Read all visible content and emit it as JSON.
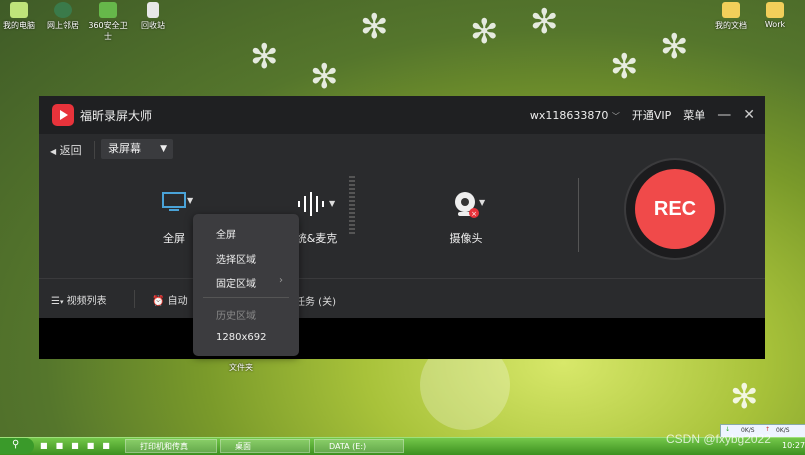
{
  "desktop": {
    "icons": [
      {
        "label": "我的电脑",
        "icon": "computer-icon"
      },
      {
        "label": "网上邻居",
        "icon": "network-icon"
      },
      {
        "label": "360安全卫士",
        "icon": "shield-app-icon"
      },
      {
        "label": "回收站",
        "icon": "recycle-bin-icon"
      },
      {
        "label": "我的文档",
        "icon": "folder-icon"
      },
      {
        "label": "Work",
        "icon": "folder-icon"
      }
    ],
    "below_window_label": "文件夹"
  },
  "app": {
    "name": "福昕录屏大师",
    "account": "wx118633870",
    "vip_label": "开通VIP",
    "menu_label": "菜单",
    "minimize_glyph": "—",
    "close_glyph": "✕",
    "back_label": "返回",
    "mode_label": "录屏幕",
    "sources": {
      "screen_label": "全屏",
      "audio_label": "系统&麦克",
      "camera_label": "摄像头"
    },
    "rec_label": "REC",
    "bottom": {
      "video_list_label": "视频列表",
      "auto_label": "自动",
      "task_label": "计划任务 (关)"
    },
    "dropdown": {
      "items": [
        "全屏",
        "选择区域",
        "固定区域"
      ],
      "history_label": "历史区域",
      "history_items": [
        "1280x692"
      ]
    }
  },
  "taskbar": {
    "items": [
      "打印机和传真",
      "桌面",
      "DATA (E:)"
    ],
    "clock": "10:27",
    "net_up": "0K/S",
    "net_down": "0K/S"
  },
  "watermark": "CSDN @fxybg2022"
}
